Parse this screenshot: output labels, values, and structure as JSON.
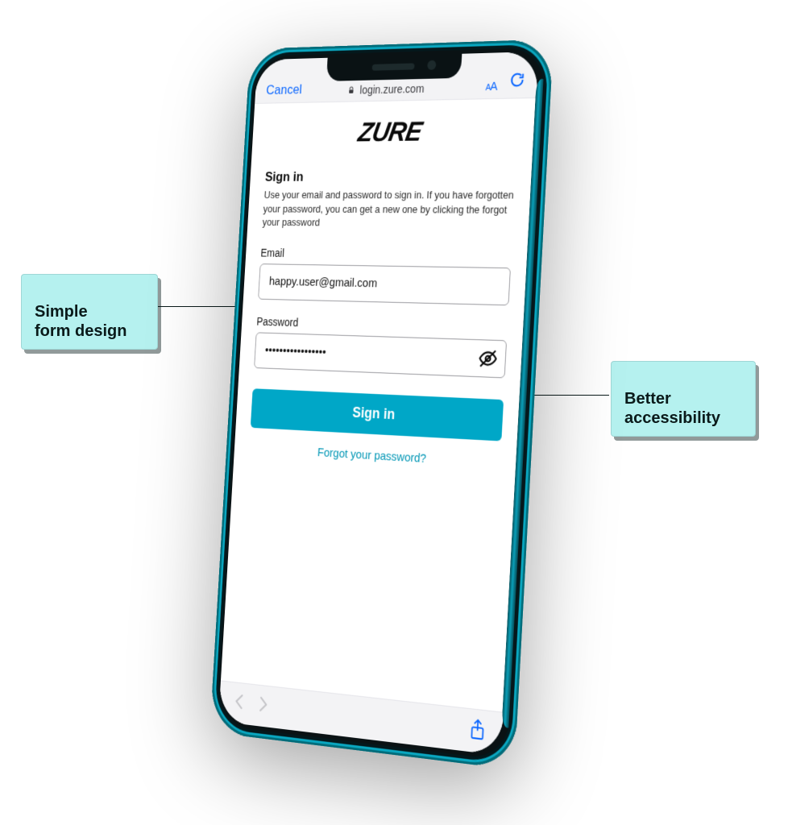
{
  "toolbar": {
    "cancel_label": "Cancel",
    "address": "login.zure.com",
    "reader_small": "A",
    "reader_large": "A"
  },
  "brand": {
    "logo_text": "ZURE"
  },
  "signin": {
    "heading": "Sign in",
    "description": "Use your email and password to sign in. If you have forgotten your password, you can get a new one by clicking the forgot your password",
    "email_label": "Email",
    "email_value": "happy.user@gmail.com",
    "password_label": "Password",
    "password_masked": "•••••••••••••••••",
    "submit_label": "Sign in",
    "forgot_label": "Forgot your password?"
  },
  "callouts": {
    "left_text": "Simple\nform design",
    "right_text": "Better\naccessibility"
  },
  "colors": {
    "accent": "#00a7c7",
    "link_blue": "#0a66ff",
    "callout_bg": "#b5f1ef"
  }
}
